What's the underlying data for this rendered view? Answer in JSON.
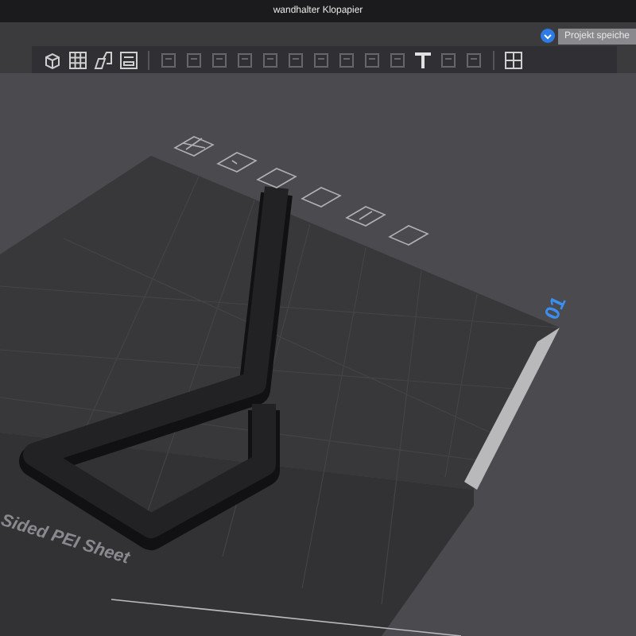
{
  "window": {
    "title": "wandhalter Klopapier"
  },
  "header": {
    "save_button": {
      "label": "Projekt speiche"
    }
  },
  "toolbar": {
    "tools": [
      {
        "kind": "cube",
        "disabled": false
      },
      {
        "kind": "grid",
        "disabled": false
      },
      {
        "kind": "shapes",
        "disabled": false
      },
      {
        "kind": "plate",
        "disabled": false
      },
      {
        "kind": "square",
        "disabled": true
      },
      {
        "kind": "square",
        "disabled": true
      },
      {
        "kind": "square",
        "disabled": true
      },
      {
        "kind": "square",
        "disabled": true
      },
      {
        "kind": "square",
        "disabled": true
      },
      {
        "kind": "square",
        "disabled": true
      },
      {
        "kind": "square",
        "disabled": true
      },
      {
        "kind": "square",
        "disabled": true
      },
      {
        "kind": "square",
        "disabled": true
      },
      {
        "kind": "square",
        "disabled": true
      },
      {
        "kind": "text",
        "disabled": false
      },
      {
        "kind": "square",
        "disabled": true
      },
      {
        "kind": "square",
        "disabled": true
      },
      {
        "kind": "assemble",
        "disabled": false
      }
    ]
  },
  "plate": {
    "number": "01",
    "sheet_label": "Sided PEI Sheet"
  }
}
